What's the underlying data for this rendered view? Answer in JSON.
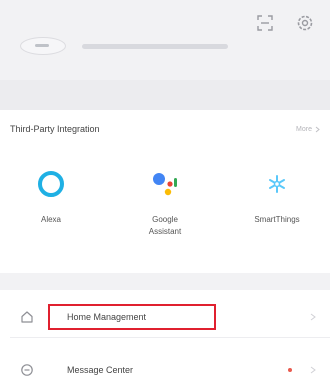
{
  "header": {
    "icons": [
      "scan-icon",
      "settings-icon"
    ]
  },
  "profile": {
    "account_name": "•••••••••••••"
  },
  "integration": {
    "title": "Third-Party Integration",
    "more_label": "More",
    "services": [
      {
        "label": "Alexa",
        "icon": "alexa-icon",
        "color": "#1fb0e4"
      },
      {
        "label": "Google\nAssistant",
        "icon": "google-assistant-icon",
        "color": "#4285f4"
      },
      {
        "label": "SmartThings",
        "icon": "smartthings-icon",
        "color": "#5ac8fa"
      }
    ]
  },
  "list": {
    "home_management": "Home Management",
    "message_center": "Message Center"
  },
  "colors": {
    "highlight": "#e0202f",
    "badge": "#e95a4e"
  }
}
